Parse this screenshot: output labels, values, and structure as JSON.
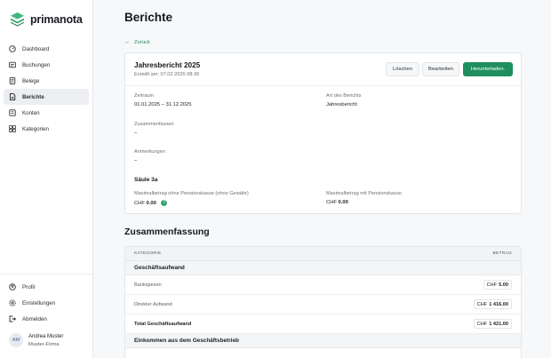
{
  "app": {
    "name": "primanota",
    "brand_color": "#1f8f5f"
  },
  "nav": {
    "items": [
      {
        "label": "Dashboard",
        "icon": "dashboard-icon"
      },
      {
        "label": "Buchungen",
        "icon": "bookings-icon"
      },
      {
        "label": "Belege",
        "icon": "receipt-icon"
      },
      {
        "label": "Berichte",
        "icon": "report-icon",
        "active": true
      },
      {
        "label": "Konten",
        "icon": "accounts-icon"
      },
      {
        "label": "Kategorien",
        "icon": "categories-icon"
      }
    ],
    "bottom": [
      {
        "label": "Profil",
        "icon": "profile-icon"
      },
      {
        "label": "Einstellungen",
        "icon": "settings-icon"
      },
      {
        "label": "Abmelden",
        "icon": "logout-icon"
      }
    ]
  },
  "user": {
    "initials": "AM",
    "name": "Andrea Muster",
    "firm": "Muster-Firma"
  },
  "page": {
    "title": "Berichte",
    "back_label": "Zurück"
  },
  "report": {
    "title": "Jahresbericht 2025",
    "created": "Erstellt am: 07.02.2026 08:30",
    "buttons": {
      "delete": "Löschen",
      "edit": "Bearbeiten",
      "download": "Herunterladen."
    },
    "period_label": "Zeitraum",
    "period_value": "01.01.2025 – 31.12.2025",
    "type_label": "Art des Berichts",
    "type_value": "Jahresbericht",
    "summary_label": "Zusammenfassen",
    "summary_value": "–",
    "notes_label": "Anmerkungen",
    "notes_value": "–",
    "pillar_title": "Säule 3a",
    "max_no_pk_label": "Maximalbetrag ohne Pensionskasse (ohne Gewähr)",
    "max_no_pk_currency": "CHF",
    "max_no_pk_value": "0.00",
    "max_pk_label": "Maximalbetrag mit Pensionskasse",
    "max_pk_currency": "CHF",
    "max_pk_value": "0.00"
  },
  "summary": {
    "title": "Zusammenfassung",
    "col_category": "KATEGORIE",
    "col_amount": "BETRAG",
    "group1": "Geschäftsaufwand",
    "rows": [
      {
        "label": "Bankspesen",
        "currency": "CHF",
        "value": "5.00",
        "bold": false
      },
      {
        "label": "Direkter Aufwand",
        "currency": "CHF",
        "value": "1 416.00",
        "bold": false
      },
      {
        "label": "Total Geschäftsaufwand",
        "currency": "CHF",
        "value": "1 421.00",
        "bold": true
      }
    ],
    "group2": "Einkommen aus dem Geschäftsbetrieb"
  }
}
